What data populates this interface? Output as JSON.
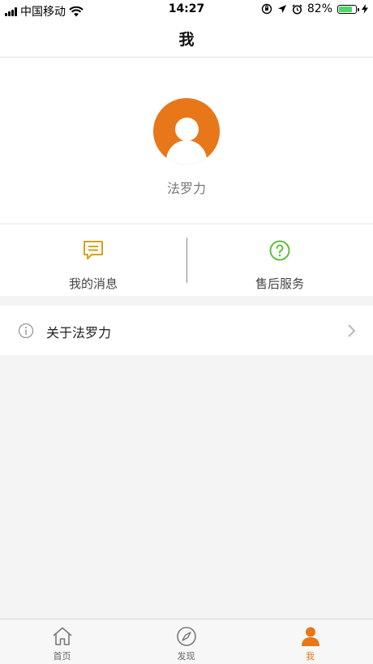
{
  "status_bar": {
    "carrier": "中国移动",
    "time": "14:27",
    "battery_percent": "82%",
    "battery_level": 0.82
  },
  "nav": {
    "title": "我"
  },
  "profile": {
    "username": "法罗力"
  },
  "actions": [
    {
      "label": "我的消息",
      "icon": "message-icon",
      "color": "#d9a21b"
    },
    {
      "label": "售后服务",
      "icon": "help-circle-icon",
      "color": "#5fbf3a"
    }
  ],
  "menu": [
    {
      "label": "关于法罗力",
      "icon": "info-icon"
    }
  ],
  "tabs": [
    {
      "label": "首页",
      "icon": "home-icon",
      "active": false
    },
    {
      "label": "发现",
      "icon": "compass-icon",
      "active": false
    },
    {
      "label": "我",
      "icon": "user-icon",
      "active": true
    }
  ],
  "colors": {
    "accent": "#e8771a",
    "background": "#f4f4f4"
  }
}
